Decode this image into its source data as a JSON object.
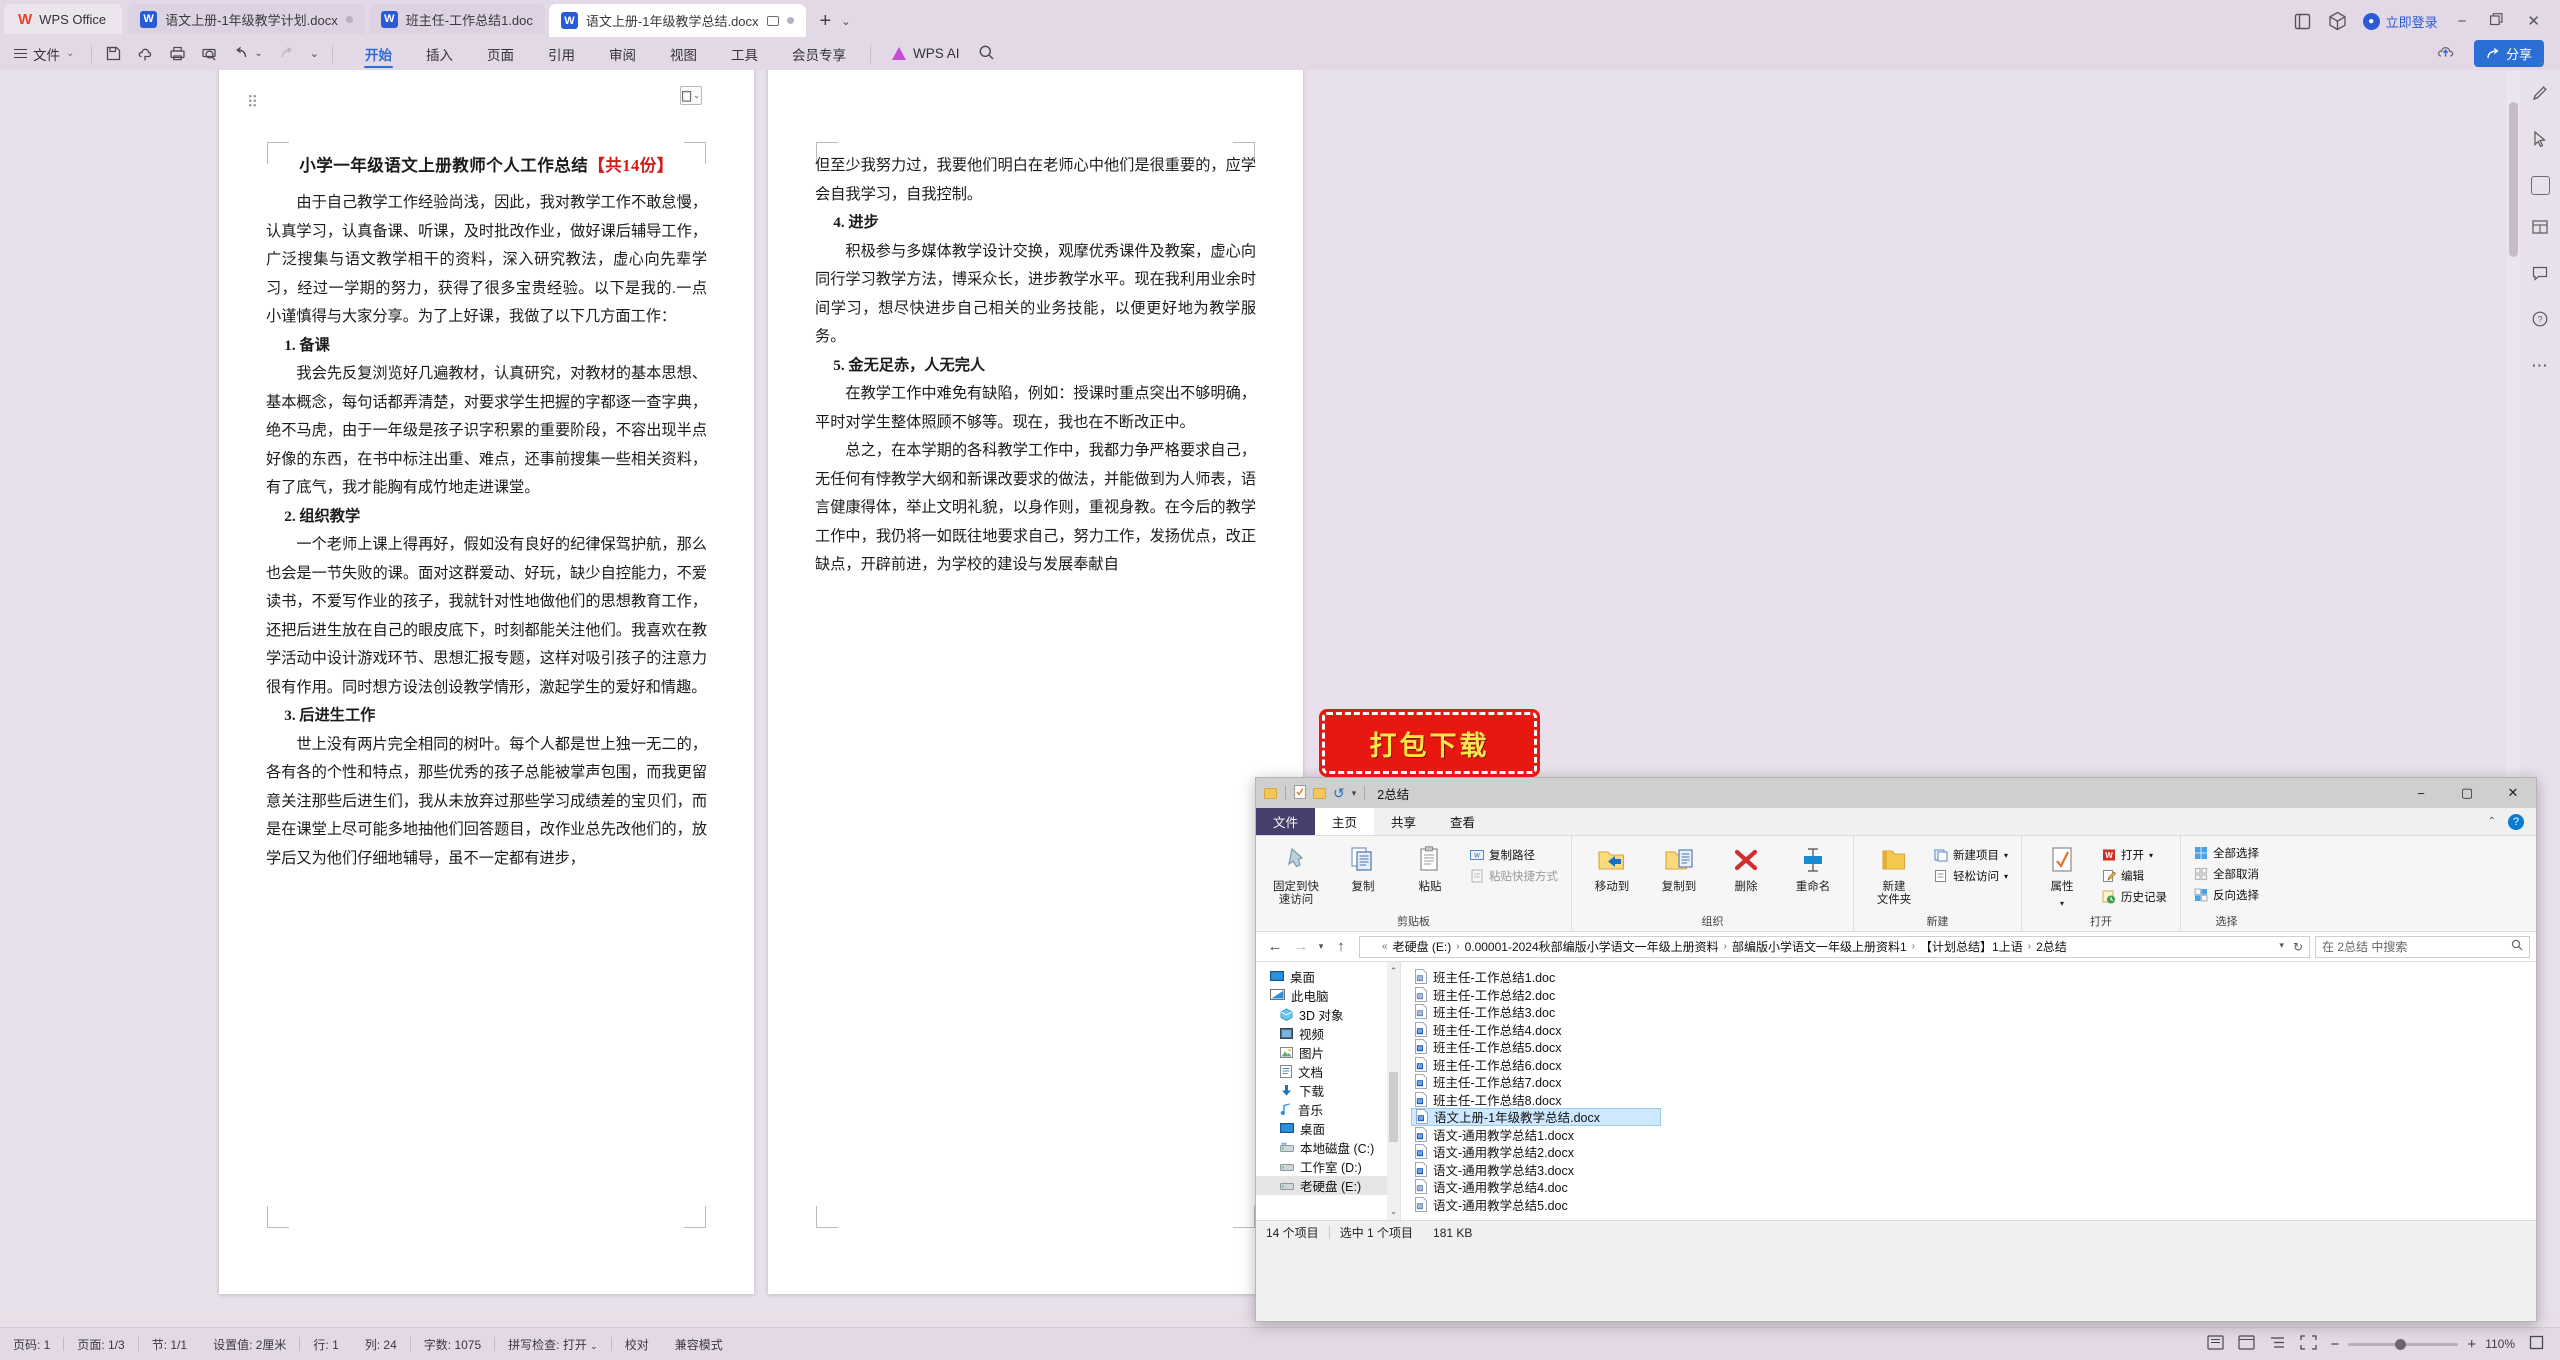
{
  "app": {
    "name": "WPS Office",
    "login_label": "立即登录",
    "share_label": "分享"
  },
  "tabs": [
    {
      "label": "语文上册-1年级教学计划.docx",
      "active": false,
      "modified": true
    },
    {
      "label": "班主任-工作总结1.doc",
      "active": false,
      "modified": false
    },
    {
      "label": "语文上册-1年级教学总结.docx",
      "active": true,
      "modified": true
    }
  ],
  "ribbon": {
    "file_label": "文件",
    "menus": [
      "开始",
      "插入",
      "页面",
      "引用",
      "审阅",
      "视图",
      "工具",
      "会员专享"
    ],
    "active_menu": "开始",
    "ai_label": "WPS AI"
  },
  "document": {
    "title_black": "小学一年级语文上册教师个人工作总结",
    "title_red": "【共14份】",
    "page1": [
      {
        "type": "p",
        "text": "由于自己教学工作经验尚浅，因此，我对教学工作不敢怠慢，认真学习，认真备课、听课，及时批改作业，做好课后辅导工作，广泛搜集与语文教学相干的资料，深入研究教法，虚心向先辈学习，经过一学期的努力，获得了很多宝贵经验。以下是我的.一点小谨慎得与大家分享。为了上好课，我做了以下几方面工作："
      },
      {
        "type": "h2",
        "text": "1. 备课"
      },
      {
        "type": "p",
        "text": "我会先反复浏览好几遍教材，认真研究，对教材的基本思想、基本概念，每句话都弄清楚，对要求学生把握的字都逐一查字典，绝不马虎，由于一年级是孩子识字积累的重要阶段，不容出现半点好像的东西，在书中标注出重、难点，还事前搜集一些相关资料，有了底气，我才能胸有成竹地走进课堂。"
      },
      {
        "type": "h2",
        "text": "2. 组织教学"
      },
      {
        "type": "p",
        "text": "一个老师上课上得再好，假如没有良好的纪律保驾护航，那么也会是一节失败的课。面对这群爱动、好玩，缺少自控能力，不爱读书，不爱写作业的孩子，我就针对性地做他们的思想教育工作，还把后进生放在自己的眼皮底下，时刻都能关注他们。我喜欢在教学活动中设计游戏环节、思想汇报专题，这样对吸引孩子的注意力很有作用。同时想方设法创设教学情形，激起学生的爱好和情趣。"
      },
      {
        "type": "h2",
        "text": "3. 后进生工作"
      },
      {
        "type": "p",
        "text": "世上没有两片完全相同的树叶。每个人都是世上独一无二的，各有各的个性和特点，那些优秀的孩子总能被掌声包围，而我更留意关注那些后进生们，我从未放弃过那些学习成绩差的宝贝们，而是在课堂上尽可能多地抽他们回答题目，改作业总先改他们的，放学后又为他们仔细地辅导，虽不一定都有进步，"
      }
    ],
    "page2": [
      {
        "type": "p",
        "text": "但至少我努力过，我要他们明白在老师心中他们是很重要的，应学会自我学习，自我控制。"
      },
      {
        "type": "h2",
        "text": "4. 进步"
      },
      {
        "type": "p",
        "text": "积极参与多媒体教学设计交换，观摩优秀课件及教案，虚心向同行学习教学方法，博采众长，进步教学水平。现在我利用业余时间学习，想尽快进步自己相关的业务技能，以便更好地为教学服务。"
      },
      {
        "type": "h2",
        "text": "5. 金无足赤，人无完人"
      },
      {
        "type": "p",
        "text": "在教学工作中难免有缺陷，例如：授课时重点突出不够明确，平时对学生整体照顾不够等。现在，我也在不断改正中。"
      },
      {
        "type": "p",
        "text": "总之，在本学期的各科教学工作中，我都力争严格要求自己，无任何有悖教学大纲和新课改要求的做法，并能做到为人师表，语言健康得体，举止文明礼貌，以身作则，重视身教。在今后的教学工作中，我仍将一如既往地要求自己，努力工作，发扬优点，改正缺点，开辟前进，为学校的建设与发展奉献自"
      }
    ]
  },
  "status_bar": {
    "items": [
      "页码: 1",
      "页面: 1/3",
      "节: 1/1",
      "设置值: 2厘米",
      "行: 1",
      "列: 24",
      "字数: 1075",
      "拼写检查: 打开",
      "校对",
      "兼容模式"
    ],
    "zoom": "110%"
  },
  "explorer": {
    "title": "2总结",
    "tabs": [
      "文件",
      "主页",
      "共享",
      "查看"
    ],
    "active_tab": "主页",
    "groups": [
      {
        "name": "剪贴板",
        "big": [
          {
            "label": "固定到快\n速访问",
            "icon": "pin-icon"
          },
          {
            "label": "复制",
            "icon": "copy-icon"
          },
          {
            "label": "粘贴",
            "icon": "paste-icon"
          }
        ],
        "small": [
          "复制路径",
          "粘贴快捷方式"
        ]
      },
      {
        "name": "组织",
        "big": [
          {
            "label": "移动到",
            "icon": "move-to-icon"
          },
          {
            "label": "复制到",
            "icon": "copy-to-icon"
          },
          {
            "label": "删除",
            "icon": "delete-icon"
          },
          {
            "label": "重命名",
            "icon": "rename-icon"
          }
        ],
        "small": []
      },
      {
        "name": "新建",
        "big": [
          {
            "label": "新建\n文件夹",
            "icon": "new-folder-icon"
          }
        ],
        "small": [
          "新建项目",
          "轻松访问"
        ]
      },
      {
        "name": "打开",
        "big": [
          {
            "label": "属性",
            "icon": "properties-icon"
          }
        ],
        "small": [
          "打开",
          "编辑",
          "历史记录"
        ]
      },
      {
        "name": "选择",
        "big": [],
        "small": [
          "全部选择",
          "全部取消",
          "反向选择"
        ]
      }
    ],
    "address": {
      "crumbs": [
        "老硬盘 (E:)",
        "0.00001-2024秋部编版小学语文一年级上册资料",
        "部编版小学语文一年级上册资料1",
        "【计划总结】1上语",
        "2总结"
      ],
      "search_placeholder": "在 2总结 中搜索"
    },
    "nav_items": [
      {
        "label": "桌面",
        "icon": "desktop-icon",
        "indent": false,
        "selected": false
      },
      {
        "label": "此电脑",
        "icon": "this-pc-icon",
        "indent": false,
        "selected": false
      },
      {
        "label": "3D 对象",
        "icon": "3d-objects-icon",
        "indent": true,
        "selected": false
      },
      {
        "label": "视频",
        "icon": "videos-icon",
        "indent": true,
        "selected": false
      },
      {
        "label": "图片",
        "icon": "pictures-icon",
        "indent": true,
        "selected": false
      },
      {
        "label": "文档",
        "icon": "documents-icon",
        "indent": true,
        "selected": false
      },
      {
        "label": "下载",
        "icon": "downloads-icon",
        "indent": true,
        "selected": false
      },
      {
        "label": "音乐",
        "icon": "music-icon",
        "indent": true,
        "selected": false
      },
      {
        "label": "桌面",
        "icon": "desktop-icon",
        "indent": true,
        "selected": false
      },
      {
        "label": "本地磁盘 (C:)",
        "icon": "drive-icon",
        "indent": true,
        "selected": false
      },
      {
        "label": "工作室 (D:)",
        "icon": "drive-icon",
        "indent": true,
        "selected": false
      },
      {
        "label": "老硬盘 (E:)",
        "icon": "drive-icon",
        "indent": true,
        "selected": true
      }
    ],
    "files": [
      {
        "name": "班主任-工作总结1.doc",
        "type": "doc",
        "selected": false
      },
      {
        "name": "班主任-工作总结2.doc",
        "type": "doc",
        "selected": false
      },
      {
        "name": "班主任-工作总结3.doc",
        "type": "doc",
        "selected": false
      },
      {
        "name": "班主任-工作总结4.docx",
        "type": "docx",
        "selected": false
      },
      {
        "name": "班主任-工作总结5.docx",
        "type": "docx",
        "selected": false
      },
      {
        "name": "班主任-工作总结6.docx",
        "type": "docx",
        "selected": false
      },
      {
        "name": "班主任-工作总结7.docx",
        "type": "docx",
        "selected": false
      },
      {
        "name": "班主任-工作总结8.docx",
        "type": "docx",
        "selected": false
      },
      {
        "name": "语文上册-1年级教学总结.docx",
        "type": "docx",
        "selected": true
      },
      {
        "name": "语文-通用教学总结1.docx",
        "type": "docx",
        "selected": false
      },
      {
        "name": "语文-通用教学总结2.docx",
        "type": "docx",
        "selected": false
      },
      {
        "name": "语文-通用教学总结3.docx",
        "type": "docx",
        "selected": false
      },
      {
        "name": "语文-通用教学总结4.doc",
        "type": "doc",
        "selected": false
      },
      {
        "name": "语文-通用教学总结5.doc",
        "type": "doc",
        "selected": false
      }
    ],
    "status": [
      "14 个项目",
      "选中 1 个项目",
      "181 KB"
    ]
  },
  "overlay": {
    "download_label": "打包下载"
  },
  "colors": {
    "accent": "#2b6fd6",
    "title_red": "#d61a16",
    "chrome": "#e3d8e6",
    "selection": "#cde8ff",
    "download_bg": "#e8170f",
    "download_text": "#f7e84c"
  }
}
